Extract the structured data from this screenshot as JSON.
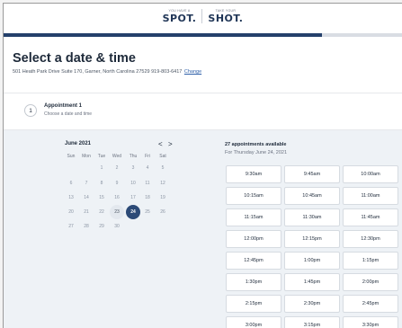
{
  "logo": {
    "left_tagline": "YOU HAVE A",
    "left_word": "SPOT.",
    "right_tagline": "TAKE YOUR",
    "right_word": "SHOT."
  },
  "progress": {
    "value_percent": 80
  },
  "page": {
    "title": "Select a date & time",
    "address": "501 Heath Park Drive Suite 170, Garner, North Carolina 27529 919-803-6417",
    "change_link": "Change"
  },
  "appointment": {
    "number": "1",
    "title": "Appointment 1",
    "subtitle": "Choose a date and time"
  },
  "calendar": {
    "month_label": "June 2021",
    "prev_symbol": "<",
    "next_symbol": ">",
    "weekdays": [
      "Sun",
      "Mon",
      "Tue",
      "Wed",
      "Thu",
      "Fri",
      "Sat"
    ],
    "weeks": [
      [
        "",
        "",
        "1",
        "2",
        "3",
        "4",
        "5"
      ],
      [
        "6",
        "7",
        "8",
        "9",
        "10",
        "11",
        "12"
      ],
      [
        "13",
        "14",
        "15",
        "16",
        "17",
        "18",
        "19"
      ],
      [
        "20",
        "21",
        "22",
        "23",
        "24",
        "25",
        "26"
      ],
      [
        "27",
        "28",
        "29",
        "30",
        "",
        "",
        ""
      ]
    ],
    "available_day": "23",
    "selected_day": "24"
  },
  "availability": {
    "count_label": "27 appointments available",
    "date_label": "For Thursday June 24, 2021"
  },
  "time_slots": [
    "9:30am",
    "9:45am",
    "10:00am",
    "10:15am",
    "10:45am",
    "11:00am",
    "11:15am",
    "11:30am",
    "11:45am",
    "12:00pm",
    "12:15pm",
    "12:30pm",
    "12:45pm",
    "1:00pm",
    "1:15pm",
    "1:30pm",
    "1:45pm",
    "2:00pm",
    "2:15pm",
    "2:30pm",
    "2:45pm",
    "3:00pm",
    "3:15pm",
    "3:30pm"
  ],
  "colors": {
    "brand_navy": "#24406b",
    "selected_day": "#2c4a77",
    "link": "#2d5fa8",
    "booking_bg": "#eef2f6"
  }
}
